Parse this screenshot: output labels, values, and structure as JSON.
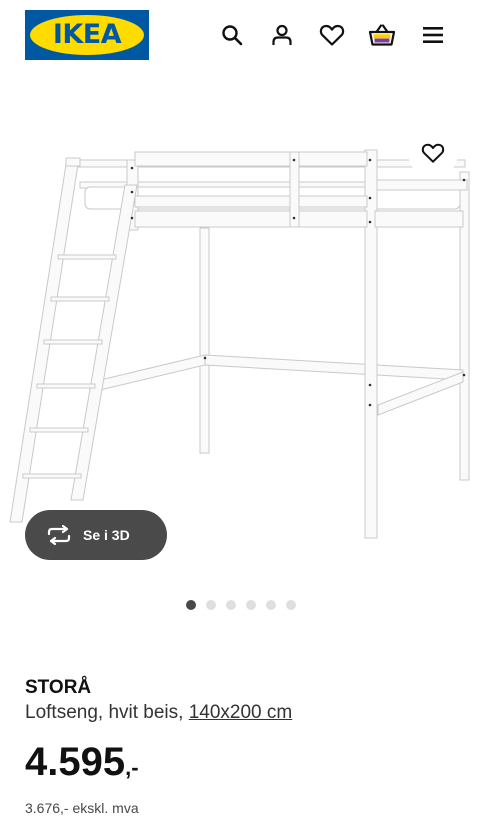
{
  "header": {
    "logo_text": "IKEA",
    "icons": [
      "search-icon",
      "user-icon",
      "heart-icon",
      "basket-icon",
      "menu-icon"
    ]
  },
  "gallery": {
    "button_3d_label": "Se i 3D",
    "image_count": 6,
    "active_index": 0
  },
  "product": {
    "name": "STORÅ",
    "description": "Loftseng, hvit beis,",
    "size_link": "140x200 cm",
    "price_int": "4.595",
    "price_dec": ",-",
    "price_ex_vat": "3.676,- ekskl. mva"
  },
  "colors": {
    "ikea_blue": "#0058a3",
    "ikea_yellow": "#ffdb00",
    "basket_yellow": "#ffcc00",
    "basket_purple": "#7b3fa0",
    "button_dark": "#4a4a4a"
  }
}
